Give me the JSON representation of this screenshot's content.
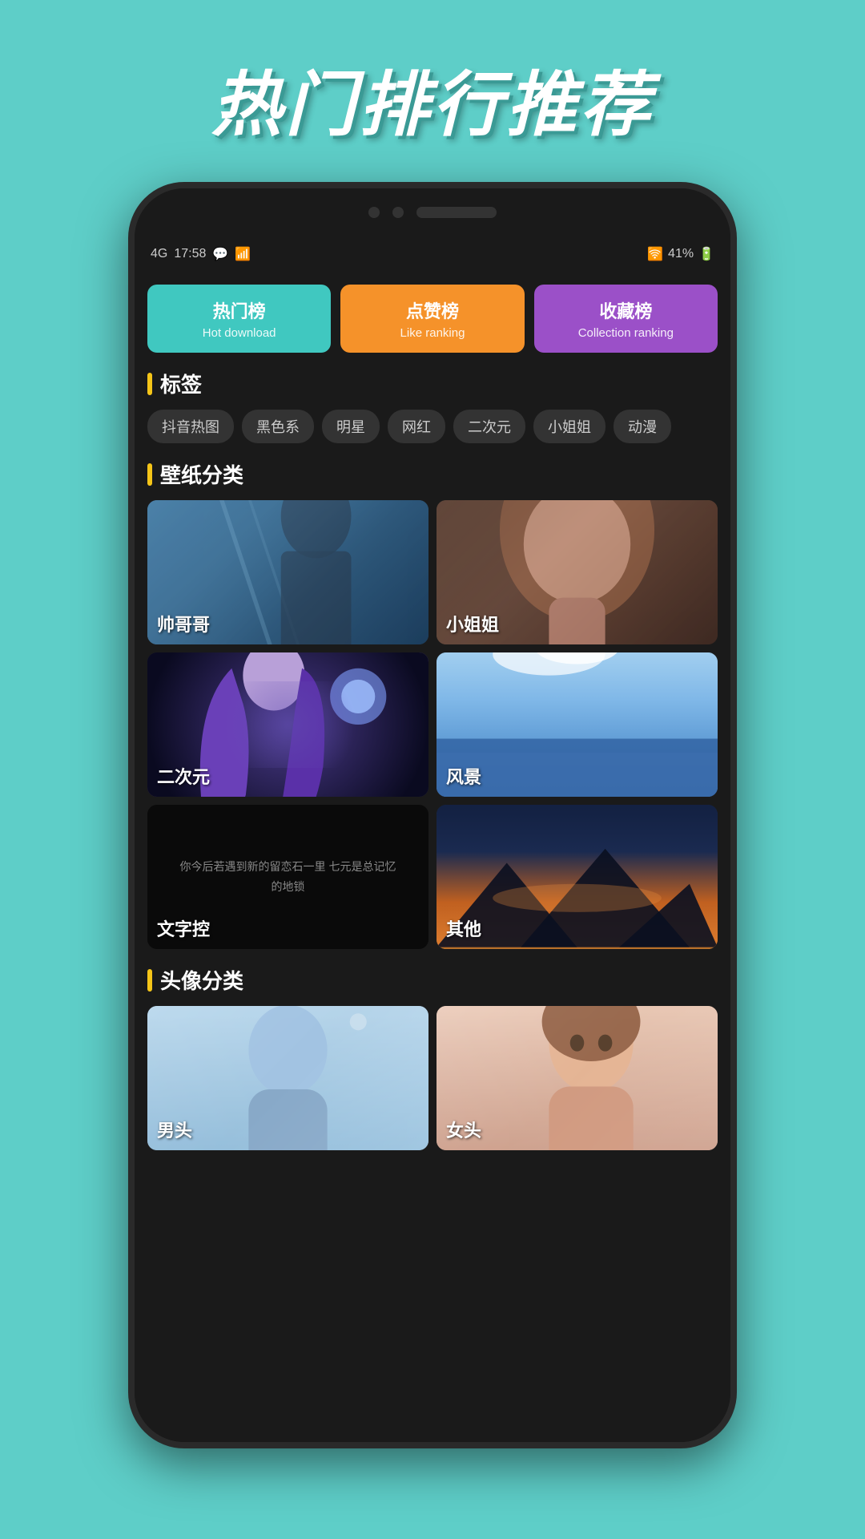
{
  "page": {
    "title": "热门排行推荐",
    "background_color": "#5ecec8"
  },
  "status_bar": {
    "time": "17:58",
    "signal": "4G",
    "battery": "41%",
    "icons": "WeChat signal wifi battery"
  },
  "tabs": [
    {
      "id": "hot",
      "main": "热门榜",
      "sub": "Hot download",
      "color": "#40c8c0"
    },
    {
      "id": "like",
      "main": "点赞榜",
      "sub": "Like ranking",
      "color": "#f5922a"
    },
    {
      "id": "collection",
      "main": "收藏榜",
      "sub": "Collection ranking",
      "color": "#9b50c8"
    }
  ],
  "sections": {
    "tags": {
      "title": "标签",
      "items": [
        "抖音热图",
        "黑色系",
        "明星",
        "网红",
        "二次元",
        "小姐姐",
        "动漫"
      ]
    },
    "wallpaper": {
      "title": "壁纸分类",
      "items": [
        {
          "id": "shuai",
          "label": "帅哥哥",
          "style": "img-shuai"
        },
        {
          "id": "jiejie",
          "label": "小姐姐",
          "style": "img-jiejie"
        },
        {
          "id": "anime",
          "label": "二次元",
          "style": "img-anime"
        },
        {
          "id": "fengjing",
          "label": "风景",
          "style": "img-fengjing"
        },
        {
          "id": "wenzi",
          "label": "文字控",
          "style": "img-wenzi"
        },
        {
          "id": "qita",
          "label": "其他",
          "style": "img-qita"
        }
      ]
    },
    "avatar": {
      "title": "头像分类",
      "items": [
        {
          "id": "male",
          "label": "男头",
          "style": "img-touxiang1"
        },
        {
          "id": "female",
          "label": "女头",
          "style": "img-touxiang2"
        }
      ]
    }
  },
  "wenzi_text": "你今后若遇到新的留恋石一里\n七元是总记忆的地锁"
}
